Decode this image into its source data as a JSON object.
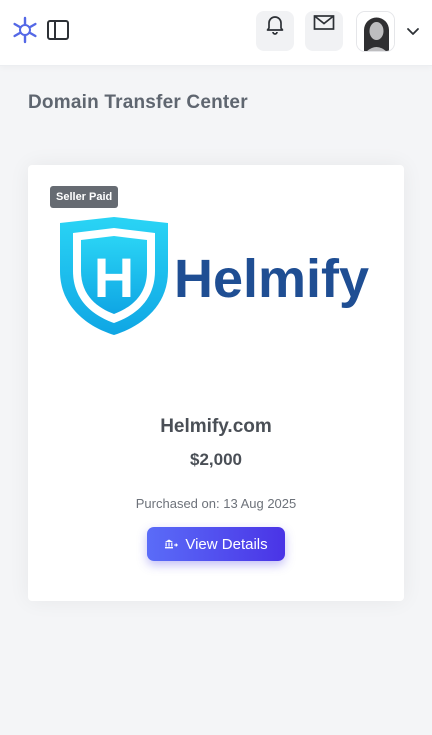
{
  "header": {
    "notifications_icon": "bell-icon",
    "messages_icon": "mail-icon",
    "sidebar_toggle_icon": "sidebar-panel-icon",
    "account_menu_icon": "chevron-down-icon"
  },
  "page": {
    "title": "Domain Transfer Center"
  },
  "card": {
    "badge": "Seller Paid",
    "logo_text": "Helmify",
    "logo_letter": "H",
    "domain": "Helmify.com",
    "price": "$2,000",
    "purchased_label": "Purchased on:",
    "purchased_date": "13 Aug 2025",
    "button_label": "View Details",
    "button_icon": "bank-transfer-icon"
  },
  "colors": {
    "accent_start": "#5a6cf8",
    "accent_end": "#4a34e6",
    "logo_blue": "#1f4e93",
    "shield_cyan": "#1fc4ee",
    "badge_bg": "#666b72"
  }
}
